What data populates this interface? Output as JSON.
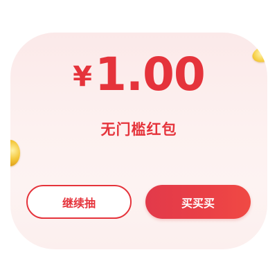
{
  "reward": {
    "currency_symbol": "¥",
    "amount": "1.00",
    "label": "无门槛红包"
  },
  "actions": {
    "continue_label": "继续抽",
    "buy_label": "买买买"
  },
  "colors": {
    "accent": "#e5333b",
    "card_background": "#fbe9e9",
    "button_fill": "#e93f48",
    "coin": "#f4c83c"
  },
  "icons": {
    "coin_right": "gold-coin-icon",
    "coin_left": "gold-coin-icon"
  }
}
